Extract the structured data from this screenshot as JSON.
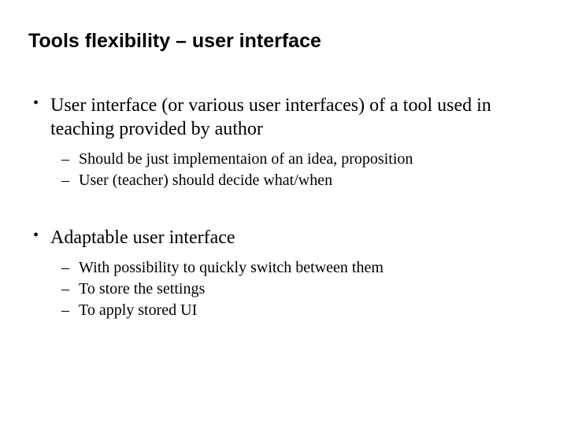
{
  "title": "Tools flexibility – user interface",
  "bullets": [
    {
      "text": "User interface (or various user interfaces) of a tool used in teaching provided by author",
      "sub": [
        "Should be just implementaion of an idea, proposition",
        "User (teacher) should decide what/when"
      ]
    },
    {
      "text": "Adaptable user interface",
      "sub": [
        "With possibility to quickly switch between them",
        "To store the settings",
        "To apply stored UI"
      ]
    }
  ]
}
